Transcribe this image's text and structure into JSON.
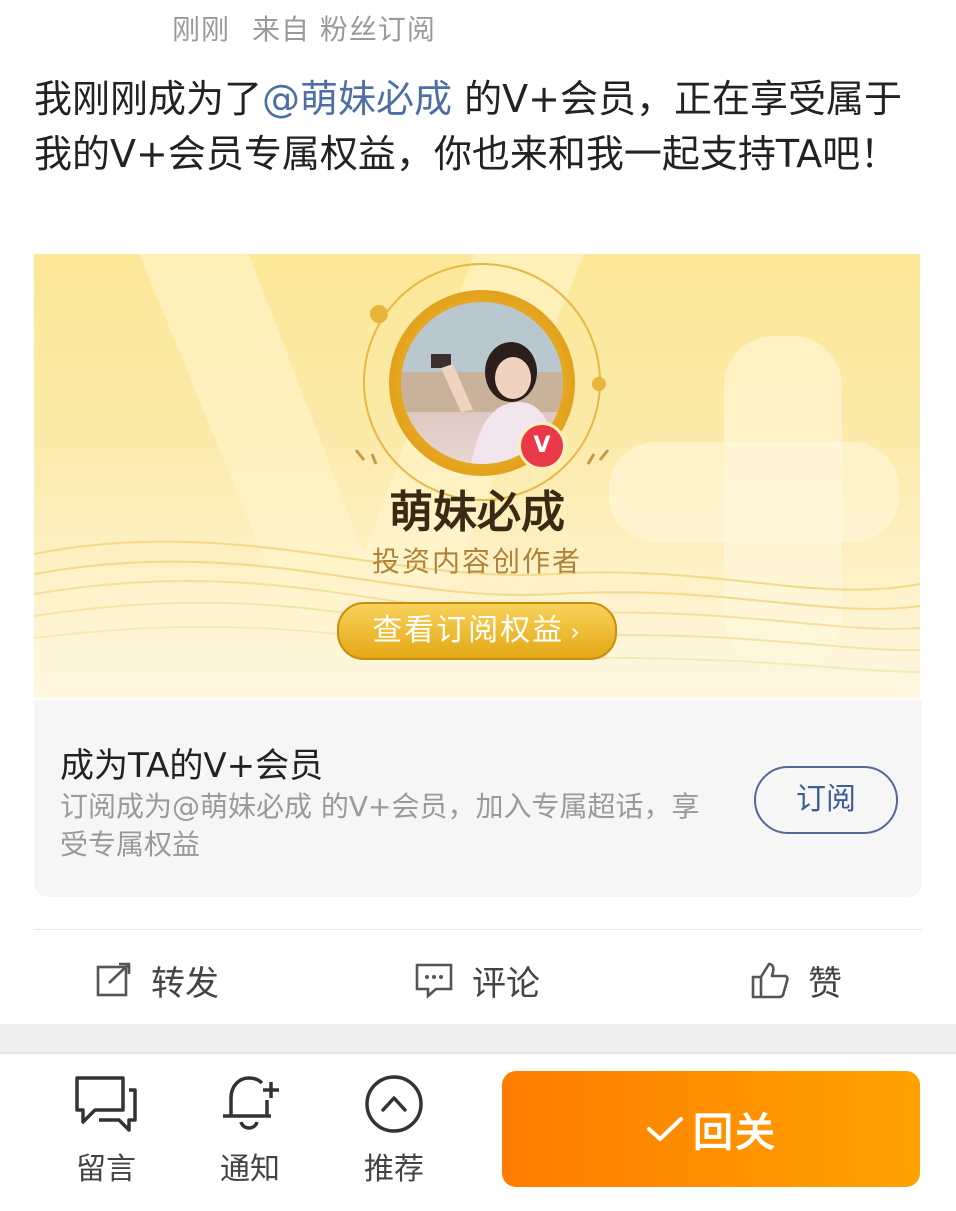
{
  "post": {
    "meta_time": "刚刚",
    "meta_source": "来自 粉丝订阅",
    "text_before": "我刚刚成为了",
    "mention": "@萌妹必成",
    "text_after": " 的V+会员，正在享受属于我的V+会员专属权益，你也来和我一起支持TA吧！"
  },
  "banner": {
    "name": "萌妹必成",
    "role": "投资内容创作者",
    "button_label": "查看订阅权益",
    "badge_letter": "V"
  },
  "card": {
    "title": "成为TA的V+会员",
    "description": "订阅成为@萌妹必成 的V+会员，加入专属超话，享受专属权益",
    "subscribe_label": "订阅"
  },
  "actions": {
    "repost": "转发",
    "comment": "评论",
    "like": "赞"
  },
  "bottom_nav": {
    "message": "留言",
    "notify": "通知",
    "recommend": "推荐",
    "follow": "回关"
  },
  "colors": {
    "accent_orange": "#ff8c00",
    "mention_blue": "#4e6fa3",
    "gold": "#e4a816"
  }
}
